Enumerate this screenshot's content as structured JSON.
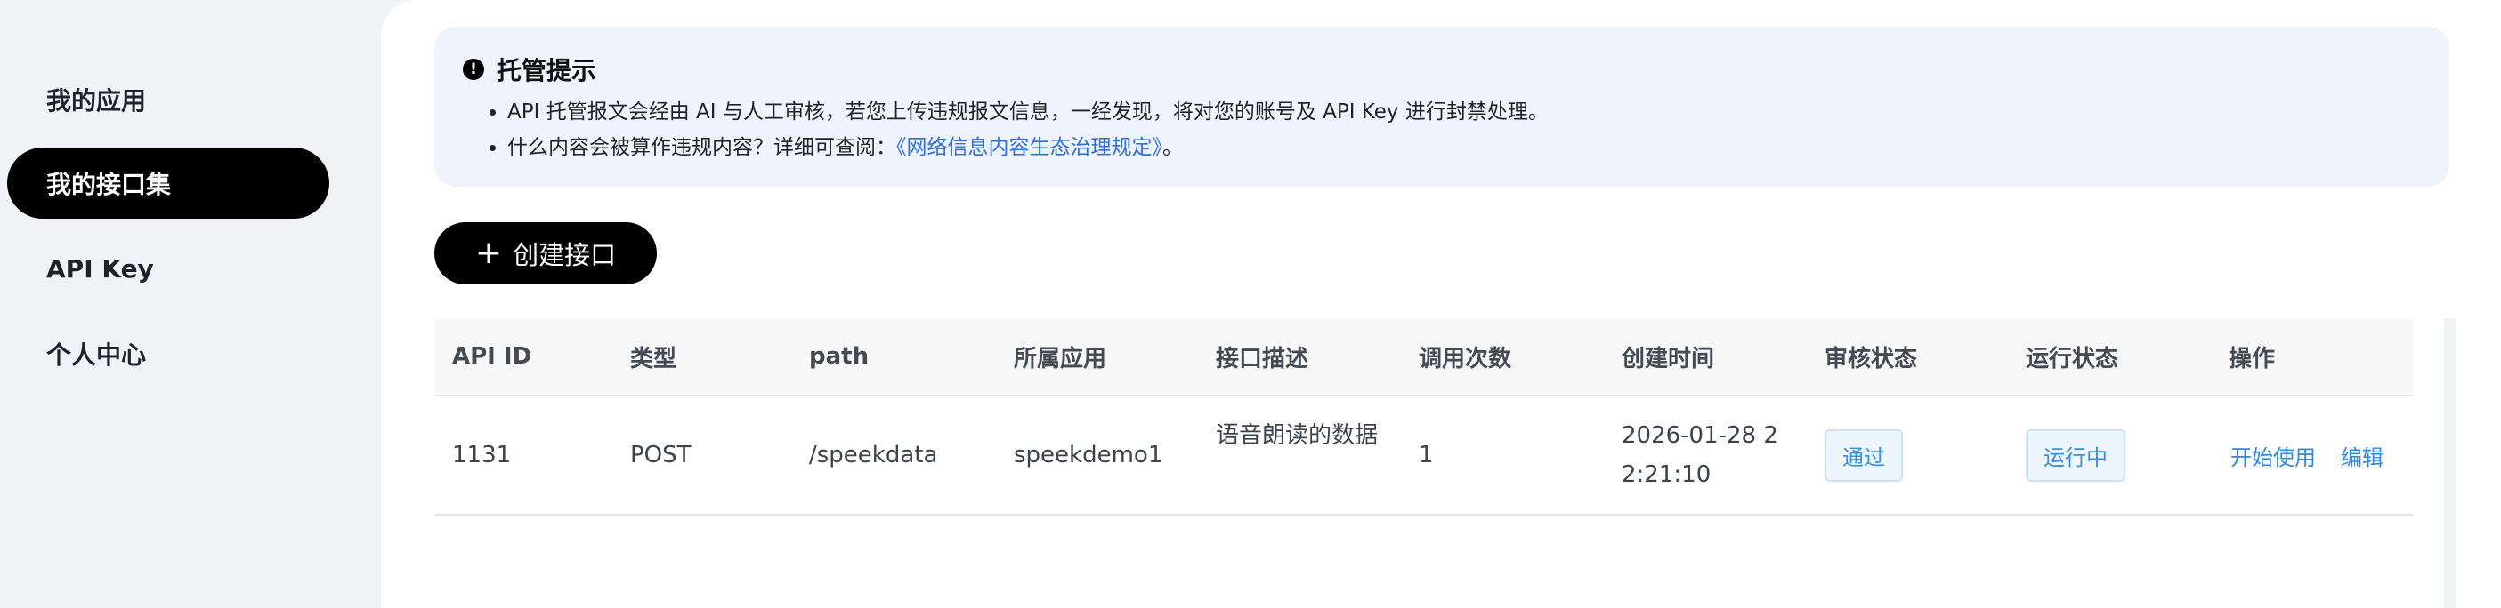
{
  "sidebar": {
    "items": [
      {
        "label": "我的应用",
        "active": false
      },
      {
        "label": "我的接口集",
        "active": true
      },
      {
        "label": "API Key",
        "active": false
      },
      {
        "label": "个人中心",
        "active": false
      }
    ]
  },
  "notice": {
    "title": "托管提示",
    "line1": "API 托管报文会经由 AI 与人工审核，若您上传违规报文信息，一经发现，将对您的账号及 API Key 进行封禁处理。",
    "line2_prefix": "什么内容会被算作违规内容？详细可查阅：",
    "line2_link": "《网络信息内容生态治理规定》",
    "line2_suffix": "。"
  },
  "create_button": {
    "label": "创建接口",
    "icon": "plus-icon"
  },
  "table": {
    "headers": [
      "API ID",
      "类型",
      "path",
      "所属应用",
      "接口描述",
      "调用次数",
      "创建时间",
      "审核状态",
      "运行状态",
      "操作"
    ],
    "rows": [
      {
        "api_id": "1131",
        "type": "POST",
        "path": "/speekdata",
        "app": "speekdemo1",
        "desc": "语音朗读的数据",
        "calls": "1",
        "created": "2026-01-28 22:21:10",
        "review": "通过",
        "run": "运行中",
        "actions": [
          "开始使用",
          "编辑"
        ]
      }
    ]
  },
  "colors": {
    "accent": "#2f8ae0",
    "link": "#2f6fdc",
    "active_nav": "#000000",
    "notice_bg": "#eef3fd"
  }
}
